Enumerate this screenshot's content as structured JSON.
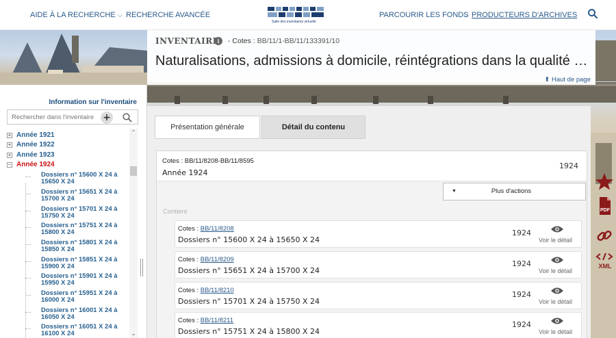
{
  "nav": {
    "aide": "AIDE À LA RECHERCHE",
    "recherche_avancee": "RECHERCHE AVANCÉE",
    "parcourir": "PARCOURIR LES FONDS",
    "producteurs": "PRODUCTEURS D'ARCHIVES",
    "logo_sub": "Salle des inventaires virtuelle"
  },
  "header": {
    "inventaire": "INVENTAIRE",
    "cotes_prefix": "- Cotes :",
    "cotes_value": "BB/11/1-BB/11/133391/10",
    "title": "Naturalisations, admissions à domicile, réintégrations dans la qualité de Français",
    "haut_de_page": "Haut de page"
  },
  "sidebar": {
    "info_title": "Information sur l'inventaire",
    "search_placeholder": "Rechercher dans l'inventaire",
    "plus_label": "+",
    "years": [
      {
        "label": "Année 1921",
        "sign": "+"
      },
      {
        "label": "Année 1922",
        "sign": "+"
      },
      {
        "label": "Année 1923",
        "sign": "+"
      },
      {
        "label": "Année 1924",
        "sign": "−"
      }
    ],
    "children": [
      "Dossiers n° 15600 X 24 à 15650 X 24",
      "Dossiers n° 15651 X 24 à 15700 X 24",
      "Dossiers n° 15701 X 24 à 15750 X 24",
      "Dossiers n° 15751 X 24 à 15800 X 24",
      "Dossiers n° 15801 X 24 à 15850 X 24",
      "Dossiers n° 15851 X 24 à 15900 X 24",
      "Dossiers n° 15901 X 24 à 15950 X 24",
      "Dossiers n° 15951 X 24 à 16000 X 24",
      "Dossiers n° 16001 X 24 à 16050 X 24",
      "Dossiers n° 16051 X 24 à 16100 X 24"
    ]
  },
  "tabs": {
    "presentation": "Présentation générale",
    "detail": "Détail du contenu"
  },
  "record": {
    "cotes": "Cotes : BB/11/8208-BB/11/8595",
    "title": "Année 1924",
    "year": "1924",
    "actions": "Plus d'actions",
    "contient": "Contient"
  },
  "children": [
    {
      "cotes_label": "Cotes :",
      "cote": "BB/11/8208",
      "title": "Dossiers n° 15600 X 24 à 15650 X 24",
      "year": "1924",
      "voir": "Voir le détail"
    },
    {
      "cotes_label": "Cotes :",
      "cote": "BB/11/8209",
      "title": "Dossiers n° 15651 X 24 à 15700 X 24",
      "year": "1924",
      "voir": "Voir le détail"
    },
    {
      "cotes_label": "Cotes :",
      "cote": "BB/11/8210",
      "title": "Dossiers n° 15701 X 24 à 15750 X 24",
      "year": "1924",
      "voir": "Voir le détail"
    },
    {
      "cotes_label": "Cotes :",
      "cote": "BB/11/8211",
      "title": "Dossiers n° 15751 X 24 à 15800 X 24",
      "year": "1924",
      "voir": "Voir le détail"
    }
  ],
  "tools": {
    "xml_label": "XML",
    "icons": [
      "star-icon",
      "pdf-icon",
      "link-icon",
      "xml-icon"
    ]
  },
  "colors": {
    "link_blue": "#2a5a8a",
    "tree_blue": "#27608f",
    "active_red": "#cc1414",
    "tool_red": "#8b1a1a"
  }
}
